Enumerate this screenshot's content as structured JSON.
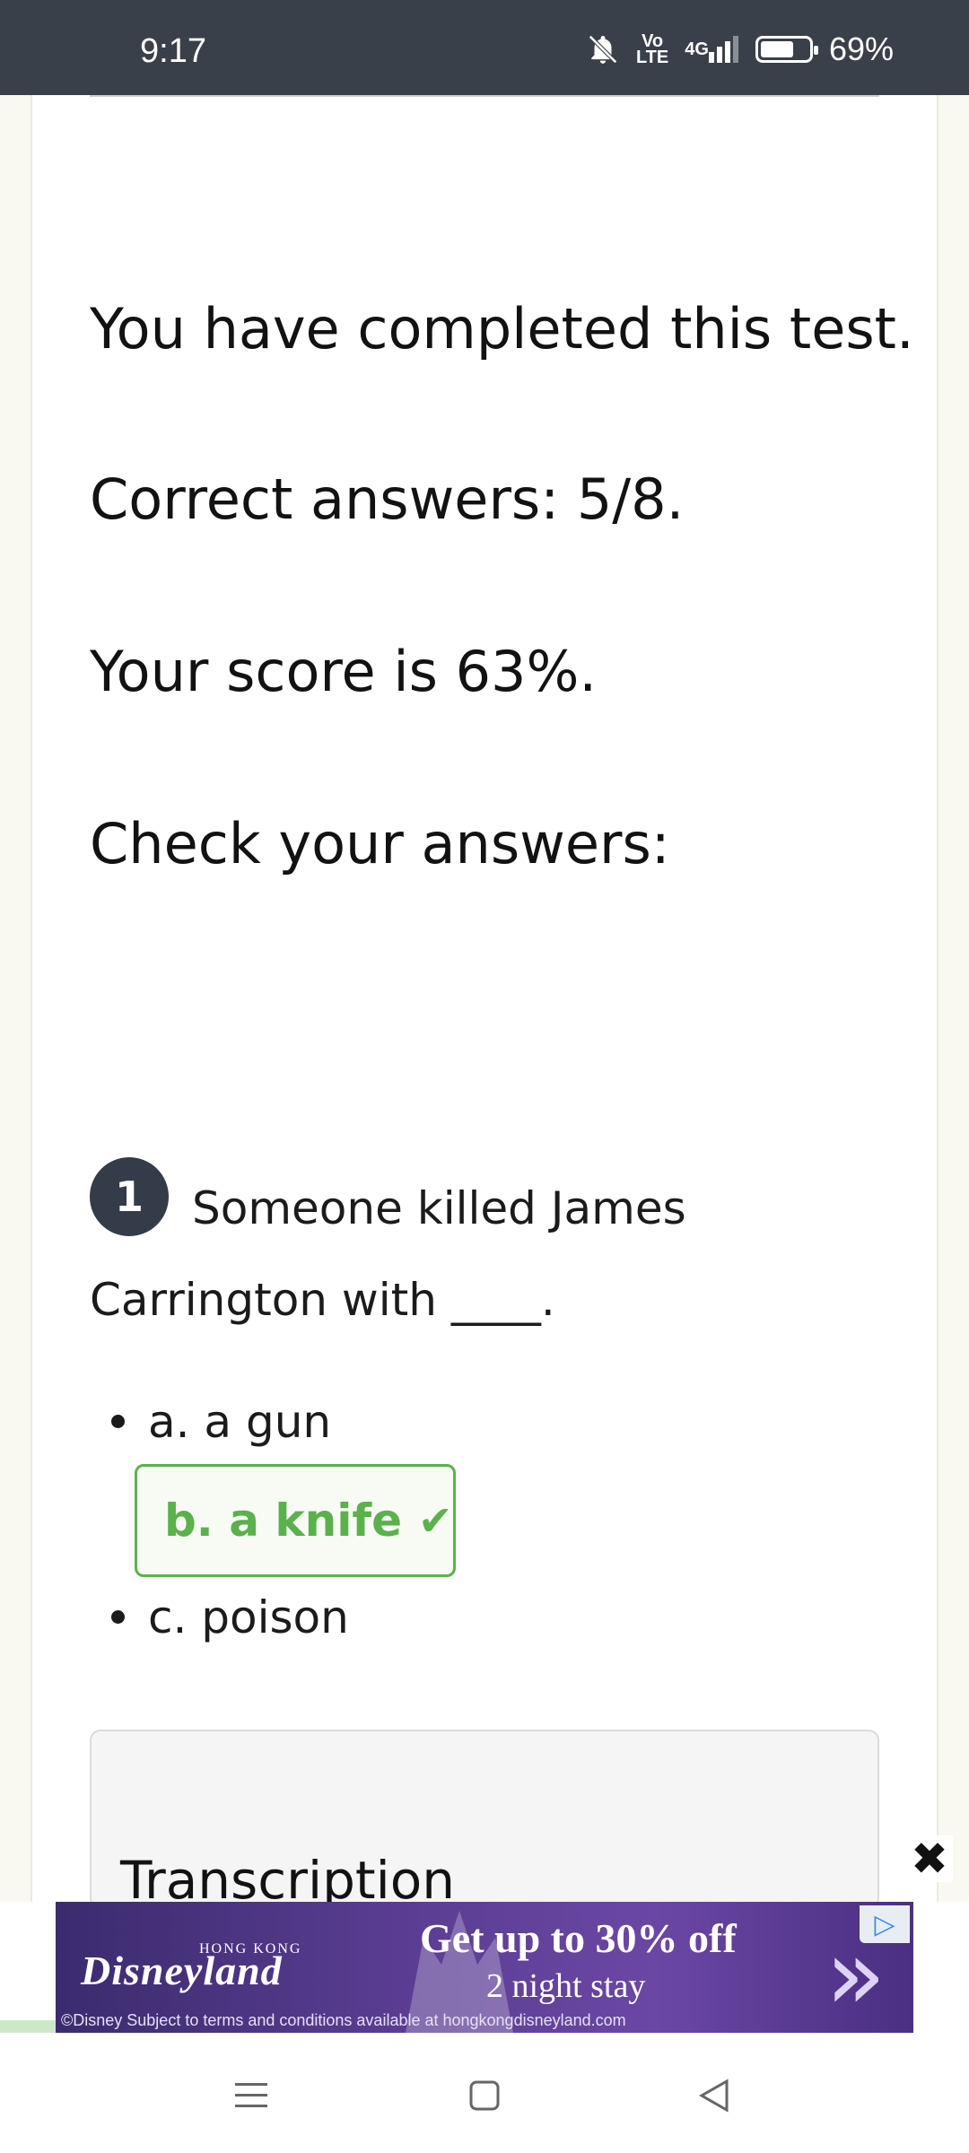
{
  "status_bar": {
    "time": "9:17",
    "volte": "Vo\nLTE",
    "network": "4G",
    "battery_percent": "69%",
    "battery_level": 0.69,
    "icons": [
      "bell-off-icon",
      "volte-icon",
      "signal-icon",
      "battery-icon"
    ]
  },
  "results": {
    "completed": "You have completed this test.",
    "correct": "Correct answers: 5/8.",
    "score": "Your score is 63%.",
    "check": "Check your answers:"
  },
  "question": {
    "number": "1",
    "text_line1": "Someone killed James",
    "text_line2": "Carrington with ____.",
    "options": [
      {
        "label": "a. a gun",
        "correct": false
      },
      {
        "label": "b. a knife",
        "correct": true
      },
      {
        "label": "c. poison",
        "correct": false
      }
    ]
  },
  "transcription": {
    "title": "Transcription"
  },
  "ad": {
    "brand_region": "HONG KONG",
    "brand": "Disneyland",
    "headline": "Get up to 30% off",
    "subline": "2 night stay",
    "legal": "©Disney      Subject to terms and conditions available at hongkongdisneyland.com",
    "colors": {
      "primary": "#5a3d92"
    }
  },
  "nav": {
    "icons": [
      "menu-icon",
      "home-icon",
      "back-icon"
    ]
  },
  "colors": {
    "correct": "#5bb14c",
    "statusbar": "#3a4049",
    "badge": "#333c48"
  }
}
